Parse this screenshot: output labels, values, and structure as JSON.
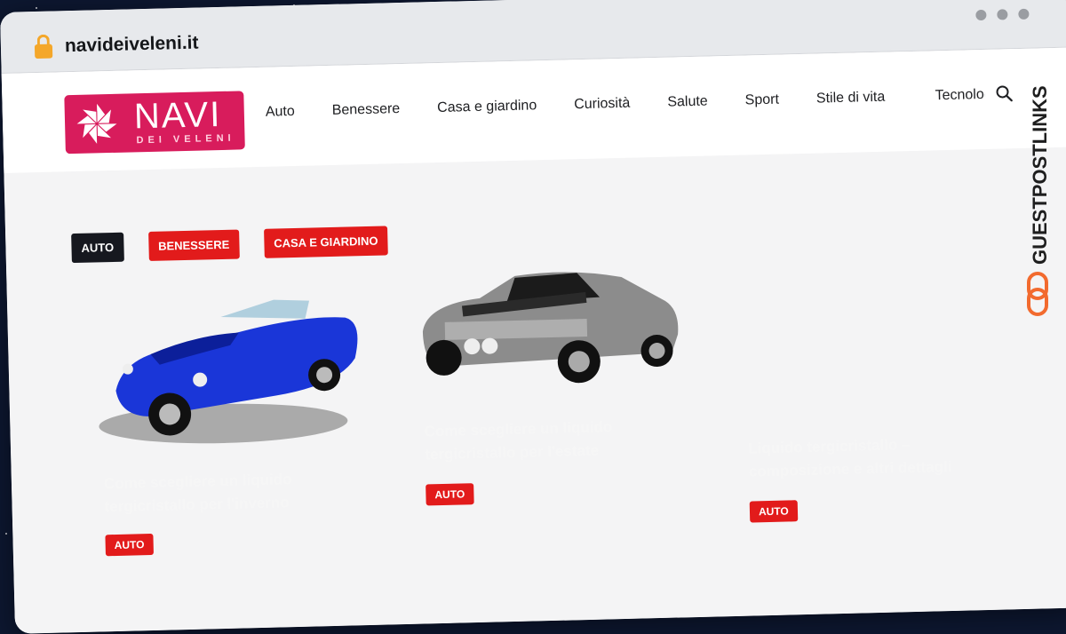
{
  "browser": {
    "url": "navideiveleni.it"
  },
  "logo": {
    "main": "NAVI",
    "sub": "DEI VELENI"
  },
  "nav": {
    "items": [
      "Auto",
      "Benessere",
      "Casa e giardino",
      "Curiosità",
      "Salute",
      "Sport",
      "Stile di vita"
    ],
    "clipped_item": "Tecnologia"
  },
  "category_tags": [
    "AUTO",
    "BENESSERE",
    "CASA E GIARDINO"
  ],
  "posts": [
    {
      "title": "Come scegliere un liquido tergicristallo per l'inverno",
      "badge": "AUTO"
    },
    {
      "title": "Come scegliere un liquido tergicristallo per l'estate",
      "badge": "AUTO"
    },
    {
      "title": "Liquido tergicristallo – composizione e altri dettagli",
      "badge": "AUTO"
    }
  ],
  "watermark": {
    "text": "GUESTPOSTLINKS"
  },
  "colors": {
    "brand": "#d81c5c",
    "tag_red": "#e21b1b",
    "tag_dark": "#16181f",
    "watermark": "#1e1e1e",
    "watermark_accent": "#f26a2e"
  }
}
